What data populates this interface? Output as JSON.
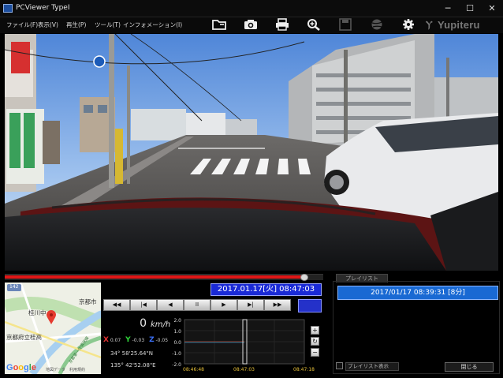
{
  "window": {
    "title": "PCViewer TypeI",
    "min": "─",
    "max": "☐",
    "close": "✕"
  },
  "menu": [
    {
      "label": "ファイル(F)"
    },
    {
      "label": "表示(V)"
    },
    {
      "label": "再生(P)"
    },
    {
      "label": "ツール(T)"
    },
    {
      "label": "インフォメーション(I)"
    }
  ],
  "toolbar": {
    "icons": [
      "folder-open-icon",
      "camera-icon",
      "print-icon",
      "zoom-icon",
      "save-icon",
      "globe-icon",
      "gear-icon"
    ],
    "brand": "Yupiteru"
  },
  "colors": {
    "seek": "#e01616",
    "datetime_bg": "#1a2ad6",
    "playlist_selected": "#1969d3"
  },
  "playback": {
    "progress": 0.94,
    "datetime": "2017.01.17[火] 08:47:03",
    "buttons": [
      "◀◀",
      "|◀",
      "◀",
      "II",
      "▶",
      "▶|",
      "▶▶"
    ]
  },
  "map": {
    "marker": "map-pin-icon",
    "labels": {
      "top_label": "京都市",
      "left_label": "桂川中",
      "school": "京都府立桂高",
      "road": "京都第一外環状線",
      "shield": "142"
    },
    "data": "地図データ　利用規約",
    "google": [
      "G",
      "o",
      "o",
      "g",
      "l",
      "e"
    ]
  },
  "telemetry": {
    "speed": "0",
    "speed_unit": "km/h",
    "g": {
      "x_label": "X",
      "x_val": "0.07",
      "y_label": "Y",
      "y_val": "-0.03",
      "z_label": "Z",
      "z_val": "-0.05"
    },
    "lat": "34° 58'25.64\"N",
    "lon": "135° 42'52.08\"E"
  },
  "graph": {
    "y_ticks": [
      "2.0",
      "1.0",
      "0.0",
      "-1.0",
      "-2.0"
    ],
    "x_ticks": [
      "08:46:48",
      "08:47:03",
      "08:47:18"
    ],
    "side_buttons": [
      "+",
      "↻",
      "−"
    ]
  },
  "playlist": {
    "tab": "プレイリスト",
    "items": [
      "2017/01/17 08:39:31 [8分]"
    ],
    "checkbox_label": "プレイリスト表示",
    "close": "閉じる"
  }
}
